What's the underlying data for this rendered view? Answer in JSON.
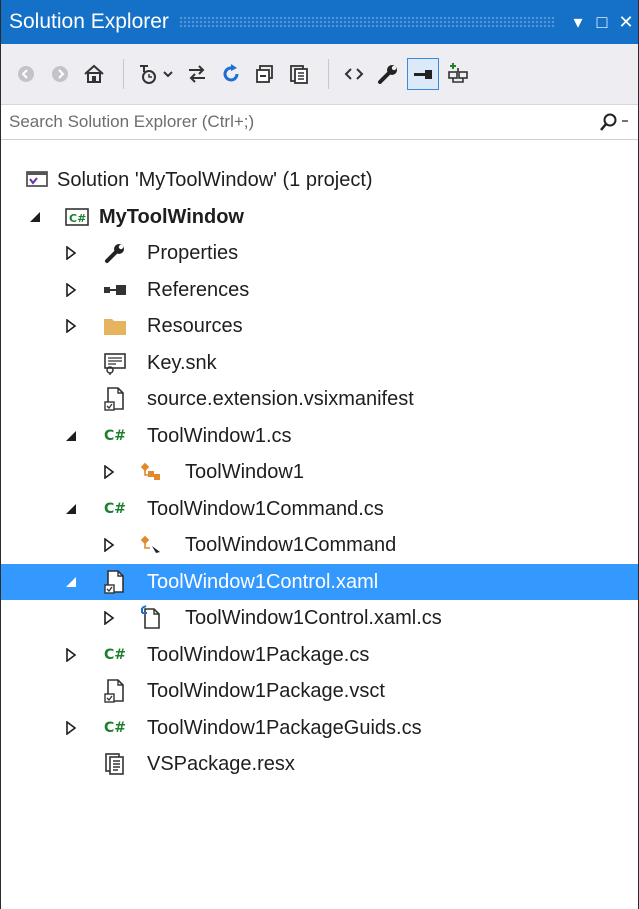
{
  "window": {
    "title": "Solution Explorer"
  },
  "title_buttons": [
    "▾",
    "□",
    "✕"
  ],
  "search": {
    "placeholder": "Search Solution Explorer (Ctrl+;)"
  },
  "tree": {
    "solution": "Solution 'MyToolWindow' (1 project)",
    "project": "MyToolWindow",
    "items": [
      "Properties",
      "References",
      "Resources",
      "Key.snk",
      "source.extension.vsixmanifest",
      "ToolWindow1.cs",
      "ToolWindow1",
      "ToolWindow1Command.cs",
      "ToolWindow1Command",
      "ToolWindow1Control.xaml",
      "ToolWindow1Control.xaml.cs",
      "ToolWindow1Package.cs",
      "ToolWindow1Package.vsct",
      "ToolWindow1PackageGuids.cs",
      "VSPackage.resx"
    ]
  },
  "colors": {
    "title_bar": "#1570c8",
    "selection": "#3399ff",
    "csharp_icon": "#1e7f2d"
  }
}
